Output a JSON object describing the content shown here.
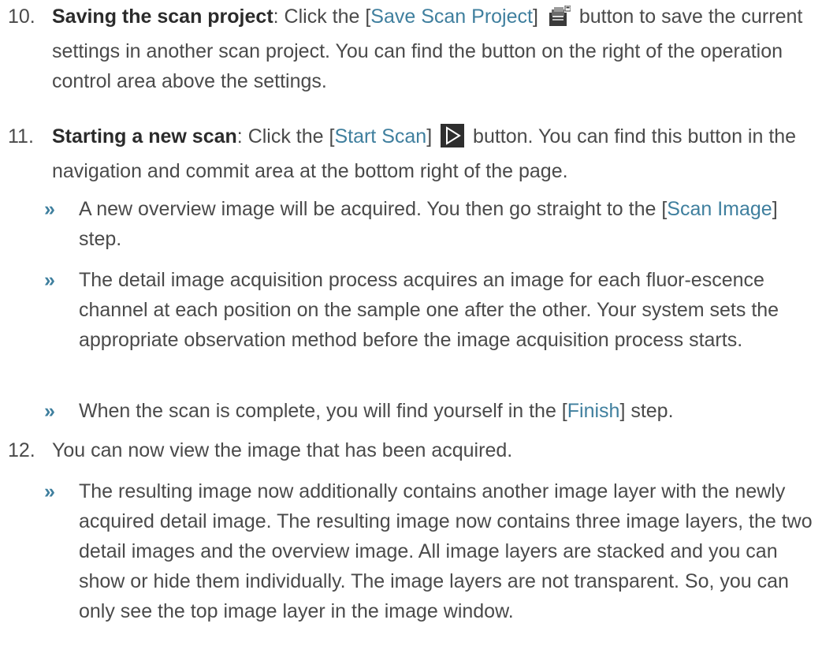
{
  "step10": {
    "number": "10.",
    "title": "Saving the scan project",
    "pre": ": Click the [",
    "ui": "Save Scan Project",
    "post_bracket": "]",
    "post_icon": " button to save the current settings in another scan project. You can find the button on the right of the operation control area above the settings.",
    "icon": "save-scan-project-icon"
  },
  "step11": {
    "number": "11.",
    "title": "Starting a new scan",
    "pre": ": Click the [",
    "ui": "Start Scan",
    "post_bracket": "]",
    "post_icon": " button. You can find this button in the navigation and commit area at the bottom right of the page.",
    "icon": "start-scan-icon",
    "results": [
      {
        "marker": "»",
        "pre": "A new overview image will be acquired. You then go straight to the [",
        "ui": "Scan Image",
        "post": "] step."
      },
      {
        "marker": "»",
        "text": "The detail image acquisition process acquires an image for each fluor-escence channel at each position on the sample one after the other. Your system sets the appropriate observation method before the image acquisition process starts."
      },
      {
        "marker": "»",
        "pre": "When the scan is complete, you will find yourself in the [",
        "ui": "Finish",
        "post": "] step."
      }
    ]
  },
  "step12": {
    "number": "12.",
    "text": "You can now view the image that has been acquired.",
    "results": [
      {
        "marker": "»",
        "text": "The resulting image now additionally contains another image layer with the newly acquired detail image. The resulting image now contains three image layers, the two detail images and the overview image. All image layers are stacked and you can show or hide them individually. The image layers are not transparent. So, you can only see the top image layer in the image window."
      }
    ]
  }
}
